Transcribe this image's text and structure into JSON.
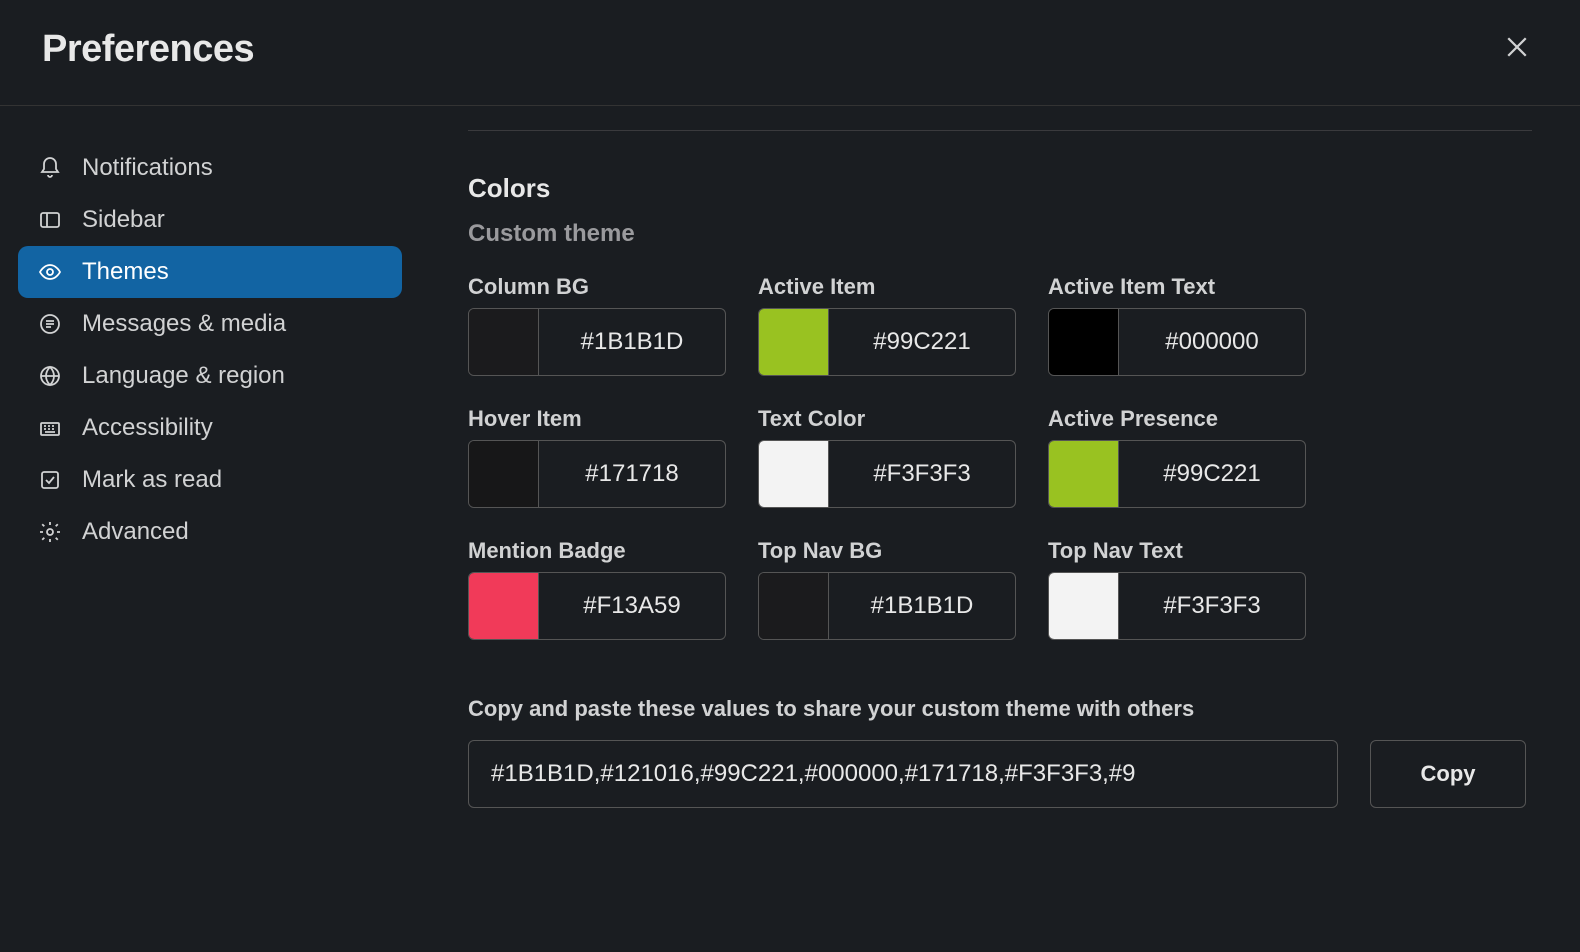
{
  "title": "Preferences",
  "sidebar": {
    "items": [
      {
        "label": "Notifications"
      },
      {
        "label": "Sidebar"
      },
      {
        "label": "Themes"
      },
      {
        "label": "Messages & media"
      },
      {
        "label": "Language & region"
      },
      {
        "label": "Accessibility"
      },
      {
        "label": "Mark as read"
      },
      {
        "label": "Advanced"
      }
    ]
  },
  "colors_section": {
    "heading": "Colors",
    "subheading": "Custom theme",
    "fields": [
      {
        "label": "Column BG",
        "hex": "#1B1B1D"
      },
      {
        "label": "Active Item",
        "hex": "#99C221"
      },
      {
        "label": "Active Item Text",
        "hex": "#000000"
      },
      {
        "label": "Hover Item",
        "hex": "#171718"
      },
      {
        "label": "Text Color",
        "hex": "#F3F3F3"
      },
      {
        "label": "Active Presence",
        "hex": "#99C221"
      },
      {
        "label": "Mention Badge",
        "hex": "#F13A59"
      },
      {
        "label": "Top Nav BG",
        "hex": "#1B1B1D"
      },
      {
        "label": "Top Nav Text",
        "hex": "#F3F3F3"
      }
    ],
    "share_label": "Copy and paste these values to share your custom theme with others",
    "share_value": "#1B1B1D,#121016,#99C221,#000000,#171718,#F3F3F3,#9",
    "copy_label": "Copy"
  }
}
